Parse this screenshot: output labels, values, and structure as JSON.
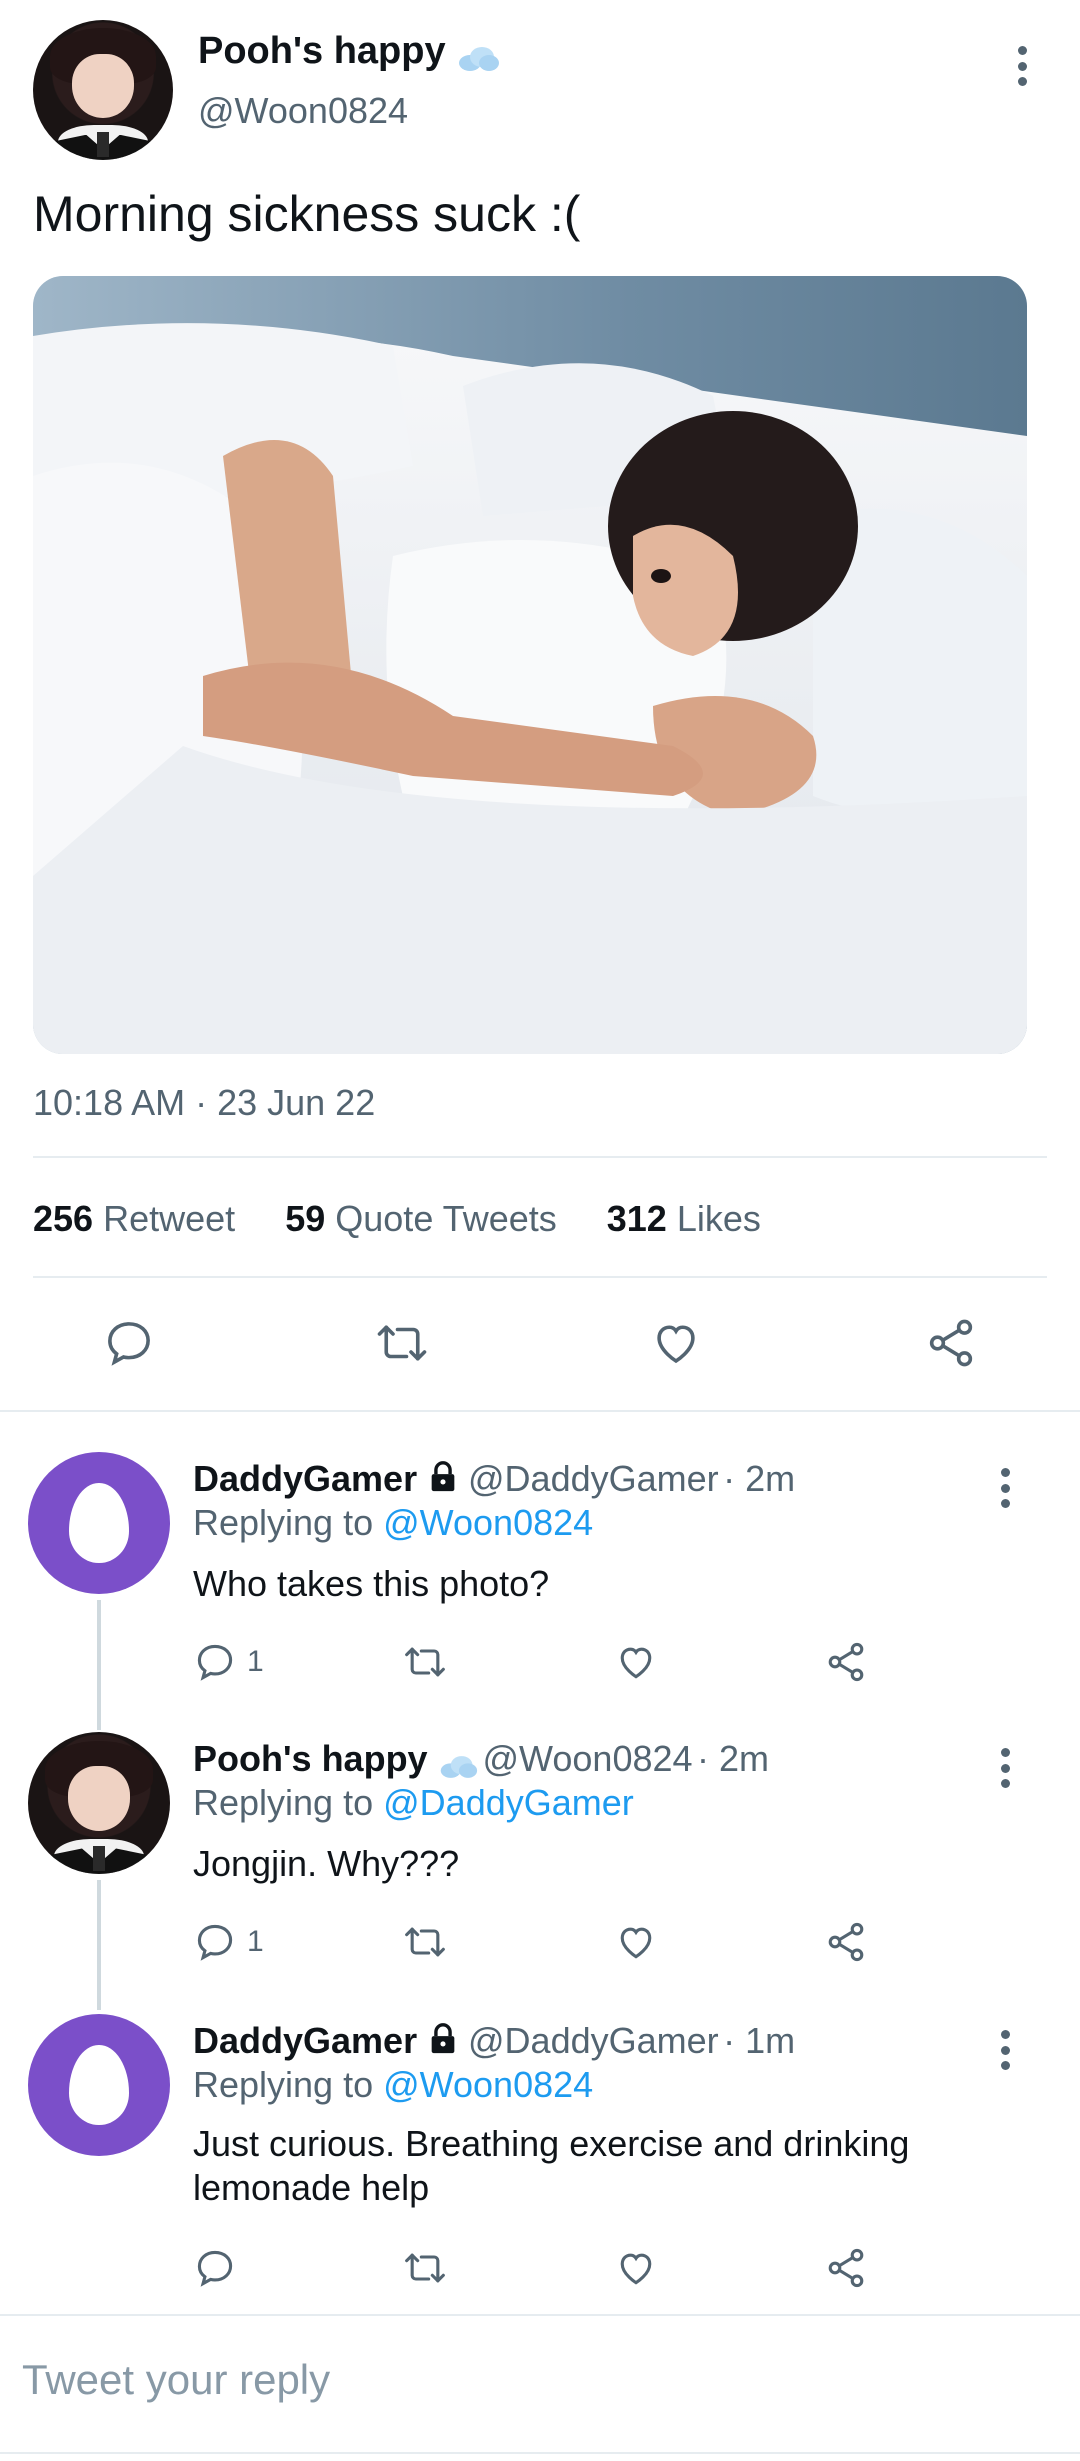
{
  "main_tweet": {
    "display_name": "Pooh's happy",
    "handle": "@Woon0824",
    "text": "Morning sickness suck :(",
    "timestamp": "10:18 AM · 23 Jun 22",
    "stats": {
      "retweets_count": "256",
      "retweets_label": "Retweet",
      "quotes_count": "59",
      "quotes_label": "Quote Tweets",
      "likes_count": "312",
      "likes_label": "Likes"
    }
  },
  "replies": [
    {
      "display_name": "DaddyGamer",
      "handle": "@DaddyGamer",
      "time": "· 2m",
      "replying_prefix": "Replying to",
      "replying_to": "@Woon0824",
      "text": "Who takes this photo?",
      "reply_count": "1"
    },
    {
      "display_name": "Pooh's happy",
      "handle": "@Woon0824",
      "time": "· 2m",
      "replying_prefix": "Replying to",
      "replying_to": "@DaddyGamer",
      "text": "Jongjin. Why???",
      "reply_count": "1"
    },
    {
      "display_name": "DaddyGamer",
      "handle": "@DaddyGamer",
      "time": "· 1m",
      "replying_prefix": "Replying to",
      "replying_to": "@Woon0824",
      "text_line1": "Just curious. Breathing exercise and drinking",
      "text_line2": "lemonade help"
    }
  ],
  "reply_box": {
    "placeholder": "Tweet your reply"
  },
  "colors": {
    "accent": "#1d9bf0",
    "egg_avatar": "#7b4fc9",
    "muted": "#536471"
  }
}
